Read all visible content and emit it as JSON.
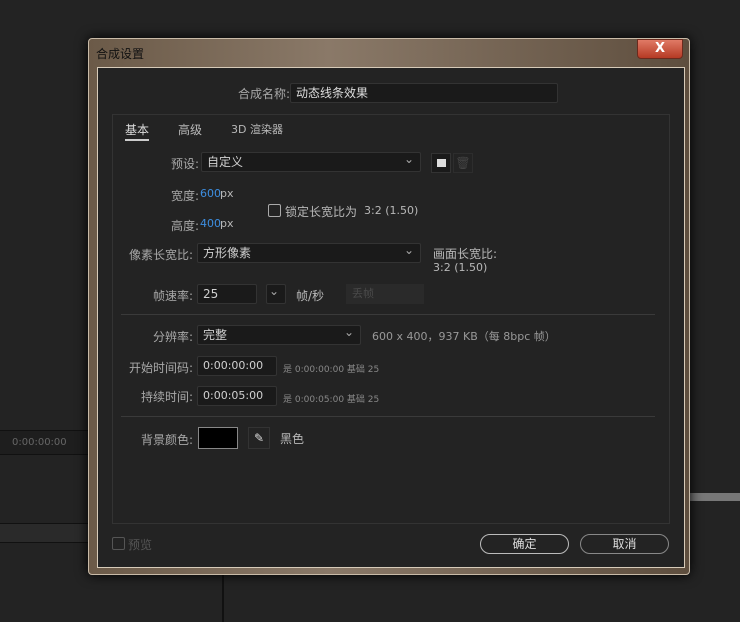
{
  "background": {
    "timecode": "0:00:00:00"
  },
  "dialog": {
    "title": "合成设置",
    "close_label": "X",
    "name_label": "合成名称:",
    "name_value": "动态线条效果",
    "tabs": [
      {
        "label": "基本"
      },
      {
        "label": "高级"
      },
      {
        "label": "3D 渲染器"
      }
    ],
    "preset_label": "预设:",
    "preset_value": "自定义",
    "width_label": "宽度:",
    "width_value": "600",
    "width_unit": "px",
    "height_label": "高度:",
    "height_value": "400",
    "height_unit": "px",
    "lock_label": "锁定长宽比为",
    "lock_ratio": "3:2 (1.50)",
    "par_label": "像素长宽比:",
    "par_value": "方形像素",
    "frame_ar_label": "画面长宽比:",
    "frame_ar_value": "3:2 (1.50)",
    "fps_label": "帧速率:",
    "fps_value": "25",
    "fps_unit": "帧/秒",
    "drop_frame": "丢帧",
    "res_label": "分辨率:",
    "res_value": "完整",
    "res_info": "600 x 400，937 KB（每 8bpc 帧）",
    "start_label": "开始时间码:",
    "start_value": "0:00:00:00",
    "start_info": "是 0:00:00:00  基础 25",
    "dur_label": "持续时间:",
    "dur_value": "0:00:05:00",
    "dur_info": "是 0:00:05:00  基础 25",
    "bg_label": "背景颜色:",
    "bg_color": "#000000",
    "bg_name": "黑色",
    "preview_label": "预览",
    "ok_label": "确定",
    "cancel_label": "取消"
  }
}
